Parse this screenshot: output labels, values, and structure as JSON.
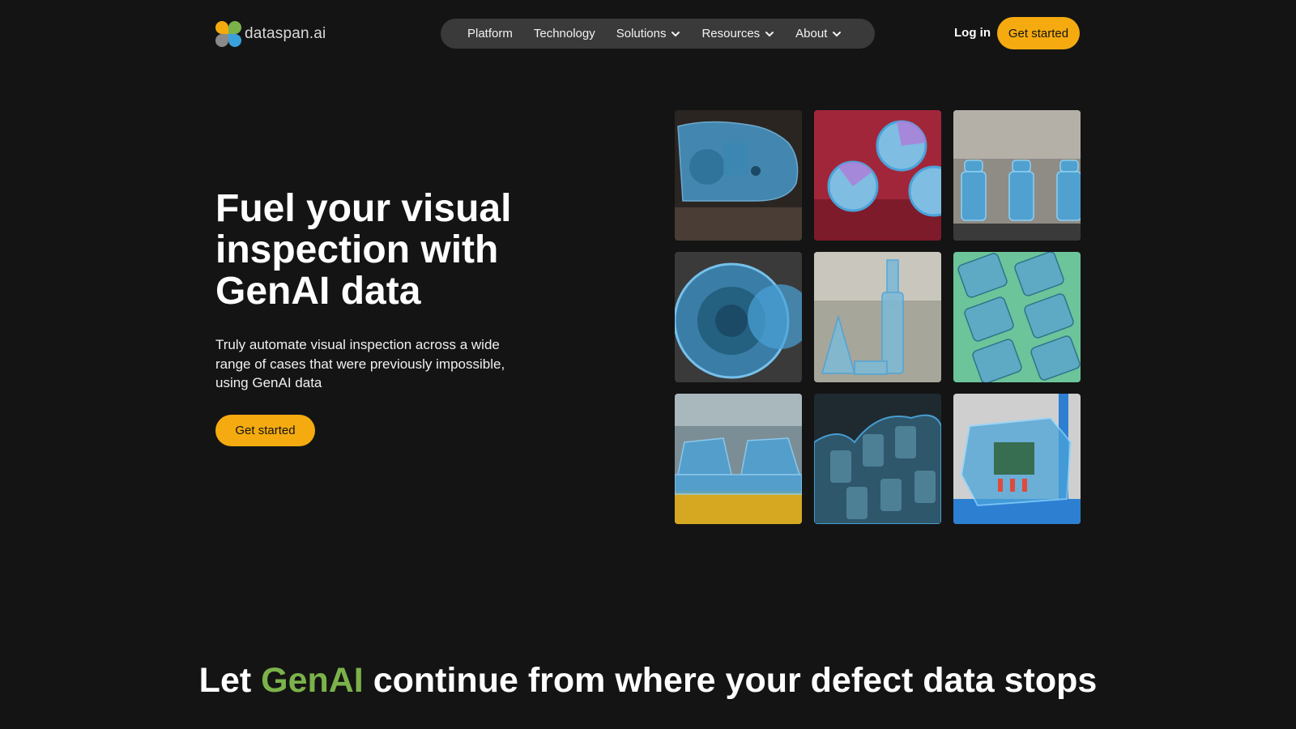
{
  "header": {
    "logo_text": "dataspan.ai",
    "nav": [
      {
        "label": "Platform",
        "has_dropdown": false
      },
      {
        "label": "Technology",
        "has_dropdown": false
      },
      {
        "label": "Solutions",
        "has_dropdown": true
      },
      {
        "label": "Resources",
        "has_dropdown": true
      },
      {
        "label": "About",
        "has_dropdown": true
      }
    ],
    "login_label": "Log in",
    "cta_label": "Get started"
  },
  "hero": {
    "title": "Fuel your visual inspection with GenAI data",
    "subtitle": "Truly automate visual inspection across a wide range of cases that were previously impossible, using GenAI data",
    "cta_label": "Get started"
  },
  "gallery": {
    "tiles": [
      {
        "icon": "train-bogie-image"
      },
      {
        "icon": "pcb-capacitors-image"
      },
      {
        "icon": "bottle-caps-image"
      },
      {
        "icon": "gear-wheel-image"
      },
      {
        "icon": "machined-shafts-image"
      },
      {
        "icon": "circuit-modules-image"
      },
      {
        "icon": "car-assembly-line-image"
      },
      {
        "icon": "roller-gears-image"
      },
      {
        "icon": "electronics-board-image"
      }
    ]
  },
  "bottom": {
    "title_part1": "Let ",
    "title_accent": "GenAI",
    "title_part2": " continue from where your defect data stops"
  },
  "colors": {
    "background": "#141414",
    "primary": "#f5ab0f",
    "accent": "#7bb24a",
    "nav_bg": "#3a3a3a",
    "overlay": "#4aa3d9"
  }
}
